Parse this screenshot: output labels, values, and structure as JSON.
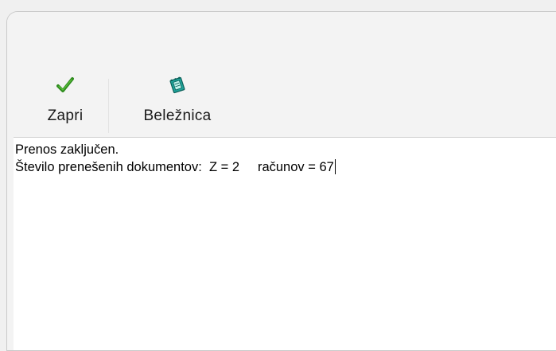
{
  "toolbar": {
    "close_label": "Zapri",
    "close_icon": "checkmark-icon",
    "notepad_label": "Beležnica",
    "notepad_icon": "notepad-icon"
  },
  "content": {
    "line1": "Prenos zaključen.",
    "line2": "Število prenešenih dokumentov:  Z = 2     računov = 67"
  },
  "colors": {
    "check_green": "#2e8b1e",
    "notepad_teal": "#1fa39a",
    "window_bg": "#f3f3f3",
    "text_bg": "#ffffff"
  }
}
